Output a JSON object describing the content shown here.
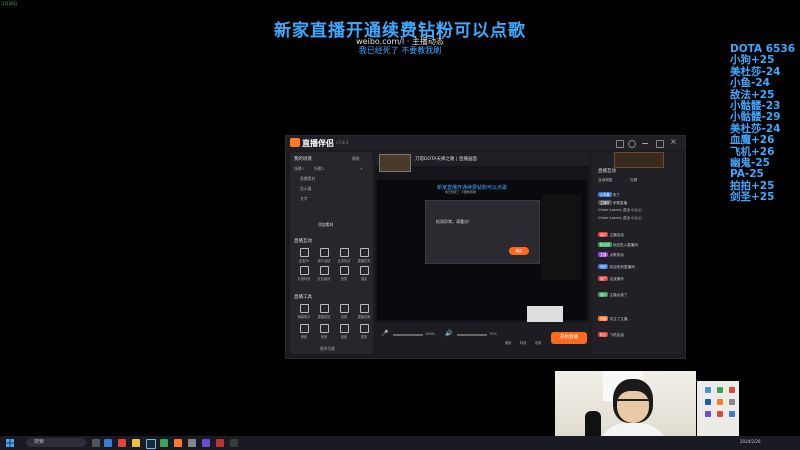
{
  "overlay": {
    "corner_label": "2月26日",
    "title": "新家直播开通续费钻粉可以点歌",
    "subtitle_line1": "weibo.com/l · 主播动态",
    "subtitle_line2": "我已经死了 不要教我刷"
  },
  "score_list": [
    "DOTA 6536",
    "小狗+25",
    "美杜莎-24",
    "小鱼-24",
    "敌法+25",
    "小骷髅-23",
    "小骷髅-29",
    "美杜莎-24",
    "血魔+26",
    "飞机+26",
    "幽鬼-25",
    "PA-25",
    "拍拍+25",
    "剑圣+25"
  ],
  "app": {
    "title": "直播伴侣",
    "version": "v7.8.1",
    "left_panel": {
      "scene_header": "我的场景",
      "scene_mode": "横屏",
      "tabs": [
        "场景1",
        "场景2",
        "+"
      ],
      "sources": [
        "直播素材",
        "显示器",
        "文字"
      ],
      "add_source": "添加素材",
      "tools_header": "直播互动",
      "tools": [
        "连麦PK",
        "观众连线",
        "互动玩法",
        "直播任务",
        "礼物特效",
        "红包福利",
        "投票",
        "抽奖"
      ],
      "more_header": "直播工具",
      "more_tools": [
        "弹幕助手",
        "直播回放",
        "剪辑",
        "直播设置",
        "美颜",
        "音效",
        "贴纸",
        "更多"
      ],
      "footer": "更多功能"
    },
    "center_panel": {
      "scene_title": "刀塔DOTA天梯之路 | 直播画面",
      "preview_banner": "新家直播开通续费钻粉可以点歌",
      "preview_banner_sub": "我已经死了 不要教我刷",
      "dialog_text": "检测异常，请重试！",
      "dialog_button": "确定",
      "mic_level": "100%",
      "speaker_level": "70%",
      "go_live_button": "开始直播",
      "bottom_labels": [
        "美颜",
        "特效",
        "设置"
      ]
    },
    "right_panel": {
      "title": "直播互动",
      "tabs": [
        "互动消息",
        "礼物"
      ],
      "chat": [
        {
          "user": "小苹果",
          "text": "来了"
        },
        {
          "user": "主播好",
          "text": "来看直播"
        },
        {
          "user": "Cheer·Lonely",
          "text": "送出 小心心"
        },
        {
          "user": "Cheer·Lonely",
          "text": "送出 小心心"
        },
        {
          "user": "观众",
          "text": "主播加油"
        },
        {
          "user": "粉丝团",
          "text": "欢迎进入直播间"
        },
        {
          "user": "主播",
          "text": "点歌成功"
        },
        {
          "user": "系统",
          "text": "欢迎来到直播间"
        },
        {
          "user": "用户",
          "text": "这波操作"
        },
        {
          "user": "观众",
          "text": "主播太强了"
        },
        {
          "user": "系统",
          "text": "关注了主播"
        },
        {
          "user": "粉丝",
          "text": "飞机加油"
        }
      ]
    }
  },
  "taskbar": {
    "search_placeholder": "搜索",
    "tray_text": "2024/2/26"
  }
}
